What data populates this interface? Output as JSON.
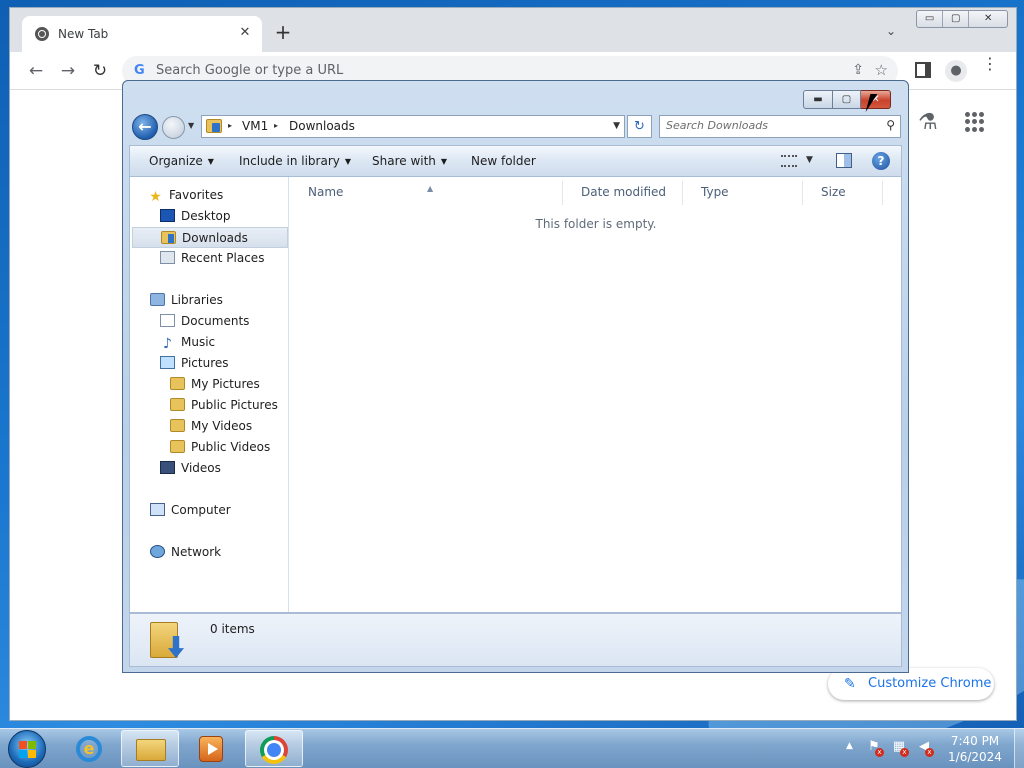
{
  "chrome": {
    "tab_title": "New Tab",
    "tab_close": "✕",
    "new_tab": "+",
    "tab_dropdown": "⌄",
    "window_buttons": [
      "▭",
      "▢",
      "✕"
    ],
    "back": "←",
    "forward": "→",
    "reload": "↻",
    "omnibox_g": "G",
    "omnibox_placeholder": "Search Google or type a URL",
    "share_icon": "⇪",
    "star_icon": "☆",
    "profile_icon": "●",
    "menu_icon": "⋮",
    "labs_icon": "⚗",
    "customize_label": "Customize Chrome",
    "customize_icon": "✎"
  },
  "explorer": {
    "back_icon": "←",
    "history_caret": "▼",
    "address": {
      "arrow": "▸",
      "segments": [
        "VM1",
        "Downloads"
      ],
      "dropdown": "▼"
    },
    "refresh_icon": "↻",
    "search_placeholder": "Search Downloads",
    "search_icon": "⚲",
    "window_buttons": {
      "minimize": "▬",
      "maximize": "▢",
      "close": "✕"
    },
    "commands": {
      "organize": "Organize",
      "include_in_library": "Include in library",
      "share_with": "Share with",
      "new_folder": "New folder",
      "caret": "▼"
    },
    "help_icon": "?",
    "nav": {
      "favorites": "Favorites",
      "desktop": "Desktop",
      "downloads": "Downloads",
      "recent_places": "Recent Places",
      "libraries": "Libraries",
      "documents": "Documents",
      "music": "Music",
      "pictures": "Pictures",
      "my_pictures": "My Pictures",
      "public_pictures": "Public Pictures",
      "my_videos": "My Videos",
      "public_videos": "Public Videos",
      "videos": "Videos",
      "computer": "Computer",
      "network": "Network"
    },
    "star_icon": "★",
    "music_icon": "♪",
    "columns": {
      "name": "Name",
      "date_modified": "Date modified",
      "type": "Type",
      "size": "Size"
    },
    "sort_caret": "▲",
    "empty_message": "This folder is empty.",
    "item_count": "0 items"
  },
  "taskbar": {
    "ie_letter": "e",
    "tray_up": "▲",
    "tray_red_mark": "x",
    "tray_flag": "⚑",
    "tray_network": "▦",
    "tray_volume": "◀",
    "time": "7:40 PM",
    "date": "1/6/2024"
  }
}
